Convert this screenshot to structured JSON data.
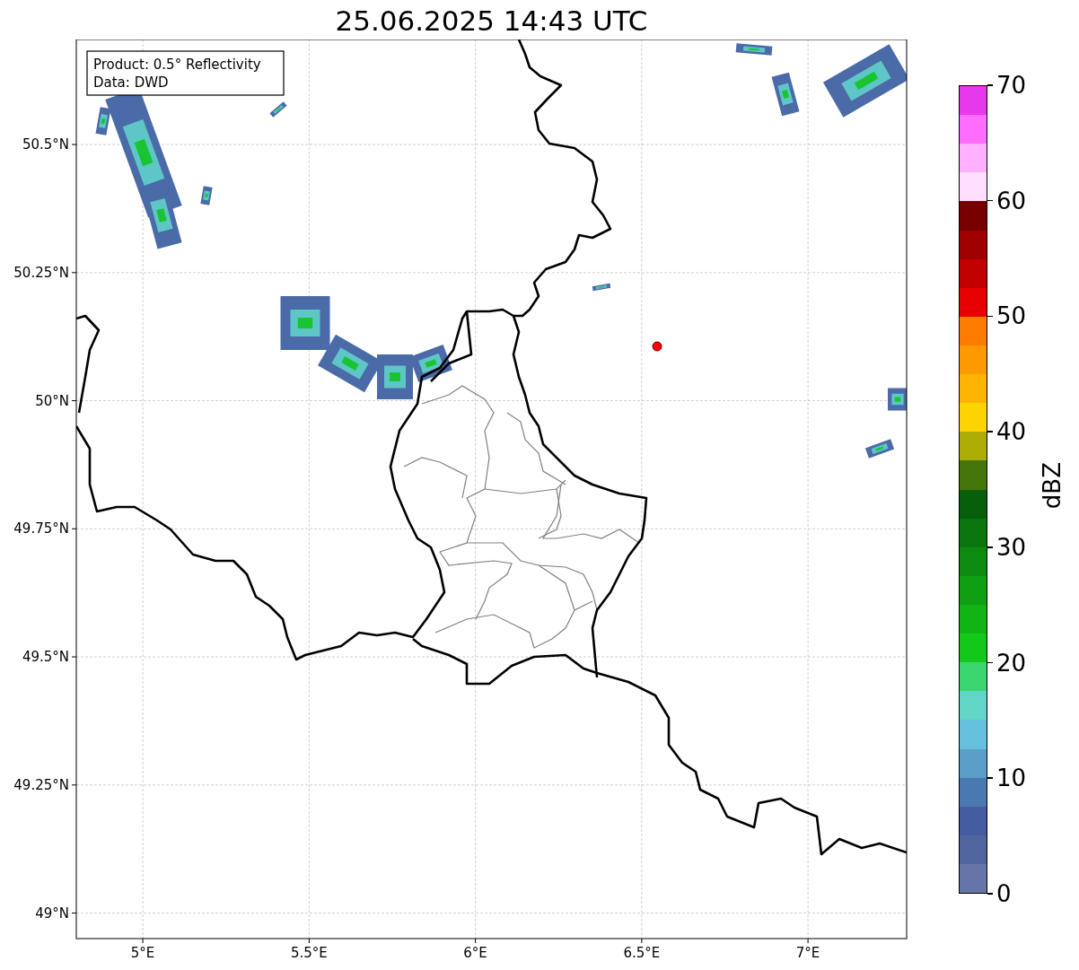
{
  "title": "25.06.2025 14:43 UTC",
  "legend": [
    "Product: 0.5° Reflectivity",
    "Data: DWD"
  ],
  "y_ticks": [
    "50.5°N",
    "50.25°N",
    "50°N",
    "49.75°N",
    "49.5°N",
    "49.25°N",
    "49°N"
  ],
  "x_ticks": [
    "5°E",
    "5.5°E",
    "6°E",
    "6.5°E",
    "7°E"
  ],
  "colorbar": {
    "ticks": [
      "70",
      "60",
      "50",
      "40",
      "30",
      "20",
      "10",
      "0"
    ],
    "segments": [
      {
        "color": "#e838ee"
      },
      {
        "color": "#ff6cff"
      },
      {
        "color": "#ffb0ff"
      },
      {
        "color": "#ffdfff"
      },
      {
        "color": "#780000"
      },
      {
        "color": "#a10000"
      },
      {
        "color": "#c20000"
      },
      {
        "color": "#e60000"
      },
      {
        "color": "#fe7c00"
      },
      {
        "color": "#fe9a00"
      },
      {
        "color": "#feb400"
      },
      {
        "color": "#fed400"
      },
      {
        "color": "#acae05"
      },
      {
        "color": "#45760c"
      },
      {
        "color": "#075f0c"
      },
      {
        "color": "#0b760e"
      },
      {
        "color": "#0d8b11"
      },
      {
        "color": "#0f9f12"
      },
      {
        "color": "#10b514"
      },
      {
        "color": "#12c91a"
      },
      {
        "color": "#3cd670"
      },
      {
        "color": "#62d6c6"
      },
      {
        "color": "#66c1df"
      },
      {
        "color": "#5b9fc8"
      },
      {
        "color": "#4a78b0"
      },
      {
        "color": "#435da0"
      },
      {
        "color": "#51659e"
      },
      {
        "color": "#6675a8"
      }
    ],
    "label": "dBZ"
  }
}
